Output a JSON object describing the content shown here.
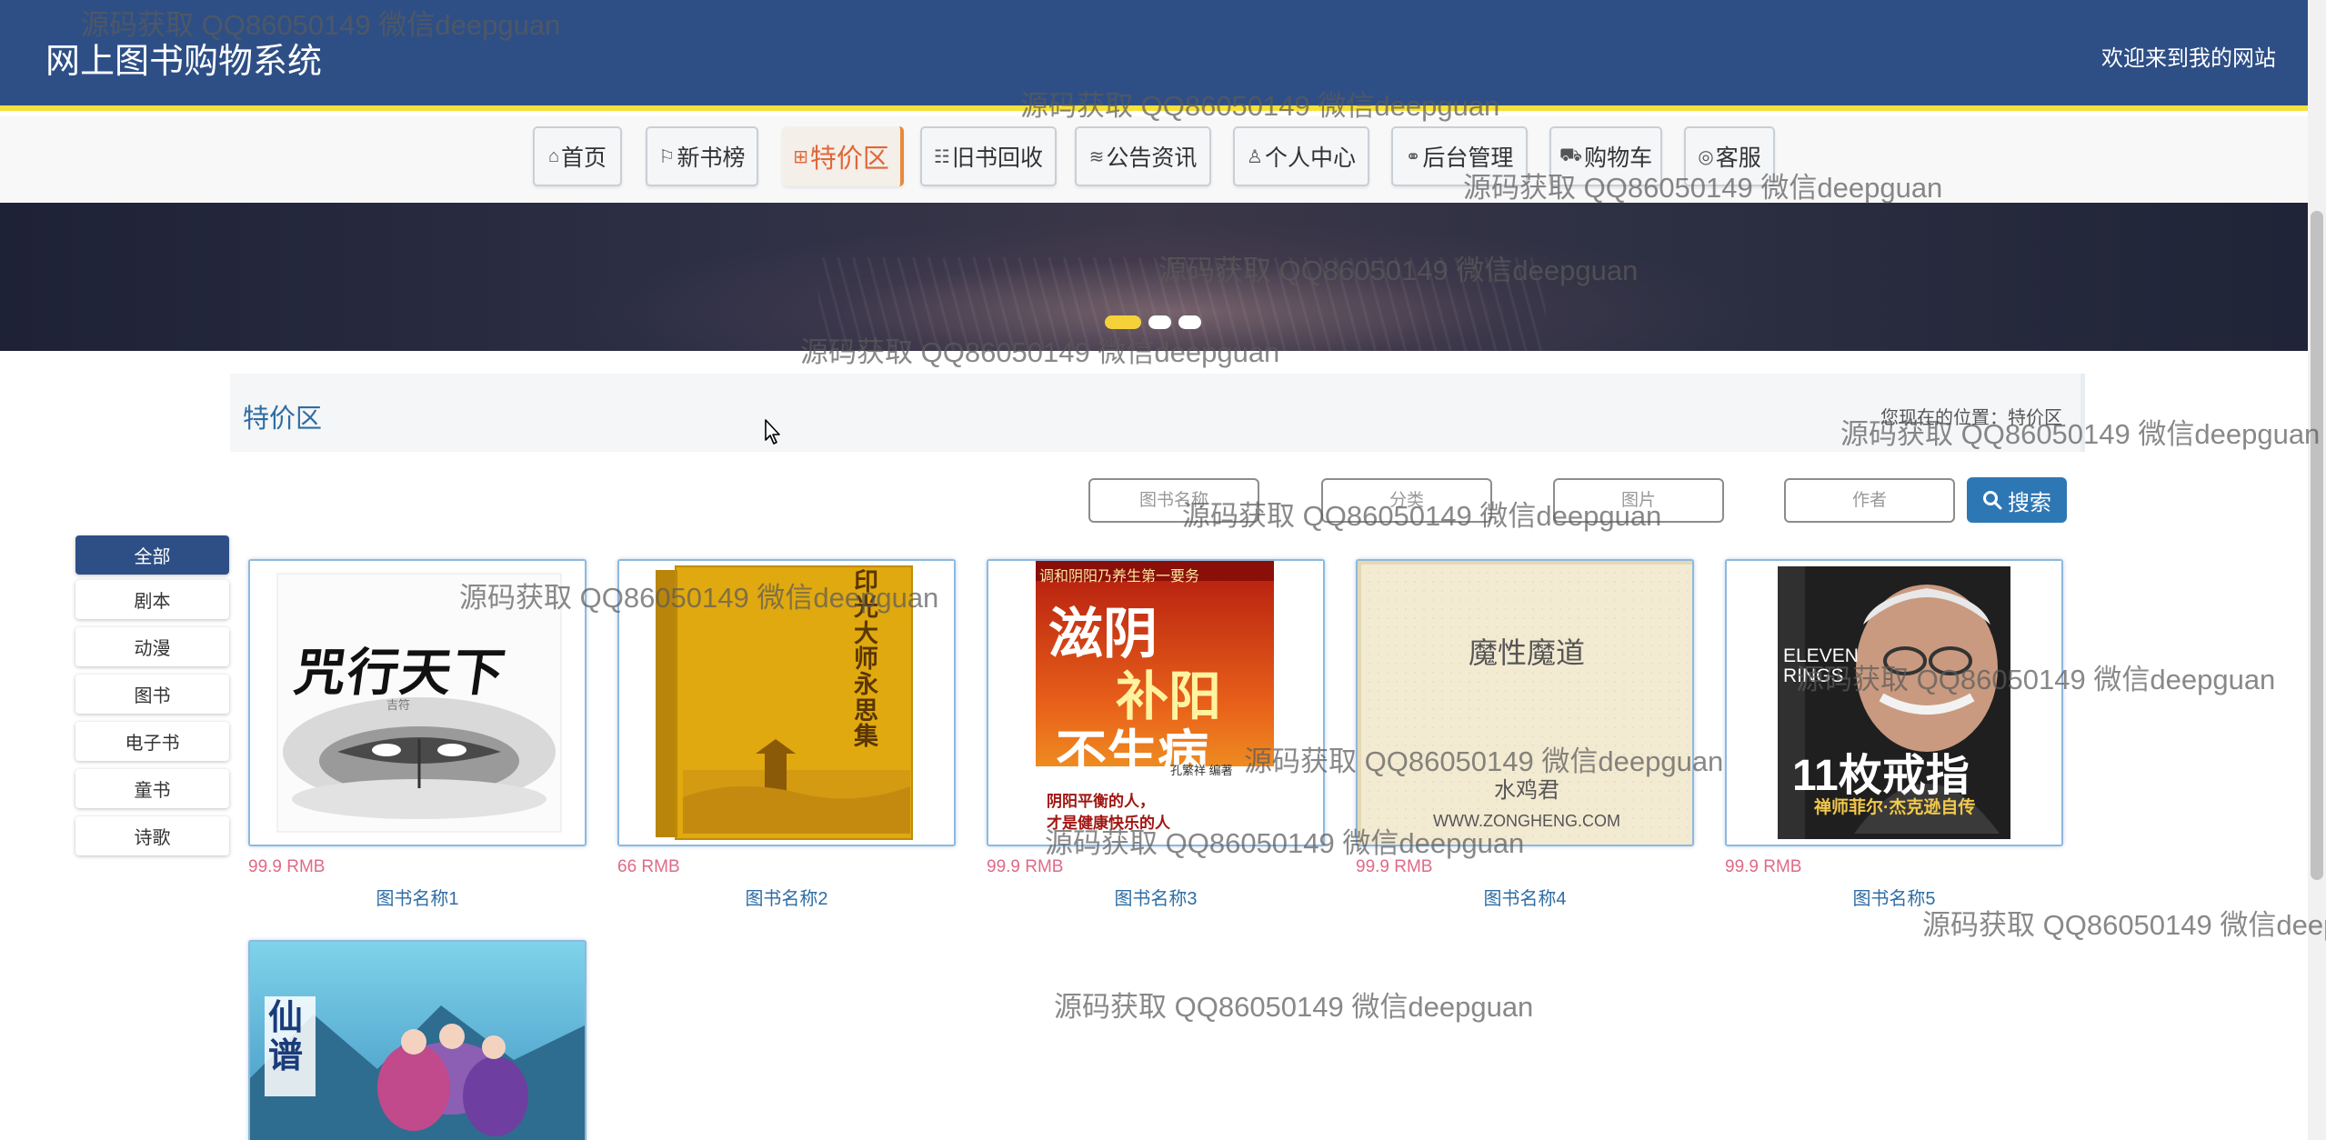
{
  "header": {
    "site_title": "网上图书购物系统",
    "welcome": "欢迎来到我的网站",
    "background_color": "#2e4f86",
    "accent_color": "#f5e13a"
  },
  "nav": {
    "items": [
      {
        "label": "首页",
        "icon": "home-icon",
        "glyph": "⌂"
      },
      {
        "label": "新书榜",
        "icon": "flag-icon",
        "glyph": "⚐"
      },
      {
        "label": "特价区",
        "icon": "grid-icon",
        "glyph": "⊞",
        "active": true
      },
      {
        "label": "旧书回收",
        "icon": "sliders-icon",
        "glyph": "☷"
      },
      {
        "label": "公告资讯",
        "icon": "layers-icon",
        "glyph": "≋"
      },
      {
        "label": "个人中心",
        "icon": "user-icon",
        "glyph": "♙"
      },
      {
        "label": "后台管理",
        "icon": "link-icon",
        "glyph": "⚭"
      },
      {
        "label": "购物车",
        "icon": "cart-icon",
        "glyph": "⛟"
      },
      {
        "label": "客服",
        "icon": "chat-icon",
        "glyph": "◎"
      }
    ]
  },
  "banner": {
    "slides": 3,
    "active_slide": 1
  },
  "page": {
    "title": "特价区",
    "location": "您现在的位置：特价区"
  },
  "search": {
    "name_placeholder": "图书名称",
    "category_placeholder": "分类",
    "image_placeholder": "图片",
    "author_placeholder": "作者",
    "button_label": "搜索"
  },
  "categories": [
    {
      "label": "全部",
      "active": true
    },
    {
      "label": "剧本"
    },
    {
      "label": "动漫"
    },
    {
      "label": "图书"
    },
    {
      "label": "电子书"
    },
    {
      "label": "童书"
    },
    {
      "label": "诗歌"
    }
  ],
  "books": [
    {
      "price": "99.9 RMB",
      "name": "图书名称1",
      "cover_title": "咒行天下",
      "cover_author": "吉符"
    },
    {
      "price": "66 RMB",
      "name": "图书名称2",
      "cover_title": "印光大师永思集"
    },
    {
      "price": "99.9 RMB",
      "name": "图书名称3",
      "cover_top": "调和阴阳乃养生第一要务",
      "cover_title_1": "滋阴",
      "cover_title_2": "补阳",
      "cover_title_3": "不生病",
      "cover_author": "孔繁祥 编著",
      "cover_tagline_1": "阴阳平衡的人，",
      "cover_tagline_2": "才是健康快乐的人"
    },
    {
      "price": "99.9 RMB",
      "name": "图书名称4",
      "cover_title": "魔性魔道",
      "cover_author": "水鸡君",
      "cover_url": "WWW.ZONGHENG.COM"
    },
    {
      "price": "99.9 RMB",
      "name": "图书名称5",
      "cover_top": "ELEVEN RINGS",
      "cover_title": "11枚戒指",
      "cover_subtitle": "禅师菲尔·杰克逊自传"
    },
    {
      "cover_title": "仙谱"
    }
  ],
  "watermark": {
    "text": "源码获取 QQ86050149 微信deepguan"
  },
  "colors": {
    "link": "#2e6da4",
    "price": "#e06a86",
    "active_nav": "#e0673a",
    "search_button": "#2e77b5"
  }
}
